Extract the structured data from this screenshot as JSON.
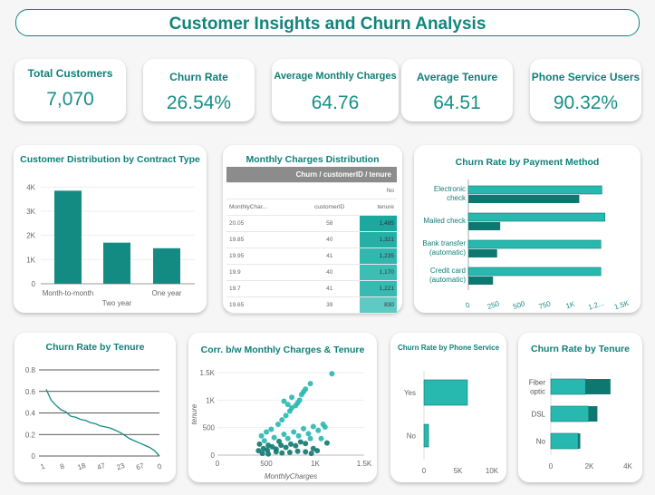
{
  "header": {
    "title": "Customer Insights and Churn Analysis"
  },
  "kpis": [
    {
      "label": "Total Customers",
      "value": "7,070"
    },
    {
      "label": "Churn Rate",
      "value": "26.54%"
    },
    {
      "label": "Average Monthly Charges",
      "value": "64.76"
    },
    {
      "label": "Average Tenure",
      "value": "64.51"
    },
    {
      "label": "Phone Service Users",
      "value": "90.32%"
    }
  ],
  "colors": {
    "accent": "#11857c",
    "bar": "#138b82",
    "bar_light": "#27b8b0",
    "bar_dark": "#0e7870"
  },
  "chart_data": [
    {
      "type": "bar",
      "title": "Customer Distribution by Contract Type",
      "categories": [
        "Month-to-month",
        "Two year",
        "One year"
      ],
      "values": [
        3850,
        1700,
        1470
      ],
      "yticks": [
        "0",
        "1K",
        "2K",
        "3K",
        "4K"
      ],
      "ylim": [
        0,
        4200
      ]
    },
    {
      "type": "table",
      "title": "Monthly Charges Distribution",
      "header": "Churn / customerID / tenure",
      "subheader": "No",
      "columns": [
        "MonthlyChar...",
        "customerID",
        "tenure"
      ],
      "rows": [
        [
          "20.05",
          "58",
          "1,485"
        ],
        [
          "19.85",
          "40",
          "1,321"
        ],
        [
          "19.95",
          "41",
          "1,235"
        ],
        [
          "19.9",
          "40",
          "1,170"
        ],
        [
          "19.7",
          "41",
          "1,221"
        ],
        [
          "19.65",
          "39",
          "830"
        ]
      ]
    },
    {
      "type": "bar",
      "orientation": "horizontal",
      "title": "Churn Rate by Payment Method",
      "categories": [
        "Electronic check",
        "Mailed check",
        "Bank transfer (automatic)",
        "Credit card (automatic)"
      ],
      "cat_lines": [
        [
          "Electronic",
          "check"
        ],
        [
          "Mailed check"
        ],
        [
          "Bank transfer",
          "(automatic)"
        ],
        [
          "Credit card",
          "(automatic)"
        ]
      ],
      "series": [
        {
          "values": [
            1300,
            1330,
            1290,
            1290
          ]
        },
        {
          "values": [
            1080,
            310,
            280,
            240
          ]
        }
      ],
      "xticks": [
        "0",
        "250",
        "500",
        "750",
        "1K",
        "1.2...",
        "1.5K"
      ],
      "xlim": [
        0,
        1500
      ]
    },
    {
      "type": "line",
      "title": "Churn Rate by Tenure",
      "x": [
        1,
        2,
        3,
        4,
        5,
        6,
        8,
        10,
        12,
        15,
        18,
        21,
        24,
        28,
        33,
        38,
        44,
        50,
        56,
        62,
        67,
        70,
        72,
        0
      ],
      "y": [
        0.62,
        0.52,
        0.47,
        0.43,
        0.41,
        0.37,
        0.36,
        0.34,
        0.33,
        0.31,
        0.3,
        0.28,
        0.27,
        0.26,
        0.24,
        0.22,
        0.19,
        0.16,
        0.14,
        0.12,
        0.1,
        0.08,
        0.05,
        0.0
      ],
      "xticks": [
        "1",
        "8",
        "18",
        "47",
        "23",
        "67",
        "0"
      ],
      "yticks": [
        "0",
        "0.2",
        "0.4",
        "0.6",
        "0.8"
      ],
      "ylim": [
        0,
        0.8
      ]
    },
    {
      "type": "scatter",
      "title": "Corr. b/w Monthly Charges & Tenure",
      "xlabel": "MonthlyCharges",
      "ylabel": "tenure",
      "xticks": [
        "0",
        "500",
        "1K",
        "1.5K"
      ],
      "yticks": [
        "0",
        "500",
        "1K",
        "1.5K"
      ],
      "xlim": [
        0,
        1500
      ],
      "ylim": [
        0,
        1500
      ],
      "points": [
        [
          420,
          80
        ],
        [
          470,
          120
        ],
        [
          510,
          90
        ],
        [
          560,
          150
        ],
        [
          600,
          110
        ],
        [
          650,
          180
        ],
        [
          700,
          140
        ],
        [
          750,
          200
        ],
        [
          800,
          170
        ],
        [
          850,
          240
        ],
        [
          900,
          210
        ],
        [
          950,
          300
        ],
        [
          430,
          200
        ],
        [
          480,
          260
        ],
        [
          520,
          180
        ],
        [
          580,
          320
        ],
        [
          630,
          250
        ],
        [
          680,
          380
        ],
        [
          720,
          300
        ],
        [
          780,
          420
        ],
        [
          830,
          350
        ],
        [
          880,
          480
        ],
        [
          930,
          390
        ],
        [
          980,
          520
        ],
        [
          1030,
          450
        ],
        [
          1080,
          560
        ],
        [
          1100,
          510
        ],
        [
          450,
          350
        ],
        [
          500,
          420
        ],
        [
          550,
          470
        ],
        [
          620,
          560
        ],
        [
          660,
          640
        ],
        [
          700,
          720
        ],
        [
          740,
          800
        ],
        [
          760,
          860
        ],
        [
          800,
          900
        ],
        [
          820,
          950
        ],
        [
          840,
          1000
        ],
        [
          860,
          1100
        ],
        [
          880,
          1150
        ],
        [
          760,
          1050
        ],
        [
          720,
          920
        ],
        [
          680,
          980
        ],
        [
          900,
          1200
        ],
        [
          950,
          1300
        ],
        [
          1170,
          1480
        ],
        [
          980,
          120
        ],
        [
          1020,
          80
        ],
        [
          1060,
          300
        ],
        [
          1120,
          220
        ],
        [
          460,
          30
        ],
        [
          520,
          20
        ],
        [
          600,
          60
        ],
        [
          660,
          40
        ],
        [
          740,
          50
        ],
        [
          820,
          70
        ],
        [
          900,
          60
        ],
        [
          960,
          30
        ]
      ]
    },
    {
      "type": "bar",
      "orientation": "horizontal",
      "title": "Churn Rate by Phone Service",
      "categories": [
        "Yes",
        "No"
      ],
      "values": [
        6400,
        680
      ],
      "xticks": [
        "0",
        "5K",
        "10K"
      ],
      "xlim": [
        0,
        10000
      ]
    },
    {
      "type": "bar",
      "orientation": "horizontal",
      "title": "Churn Rate by Tenure",
      "categories": [
        "Fiber optic",
        "DSL",
        "No"
      ],
      "cat_lines": [
        [
          "Fiber",
          "optic"
        ],
        [
          "DSL"
        ],
        [
          "No"
        ]
      ],
      "series": [
        {
          "name": "No",
          "values": [
            1800,
            1960,
            1420
          ]
        },
        {
          "name": "Yes",
          "values": [
            1300,
            460,
            110
          ]
        }
      ],
      "xticks": [
        "0",
        "2K",
        "4K"
      ],
      "xlim": [
        0,
        4000
      ]
    }
  ]
}
